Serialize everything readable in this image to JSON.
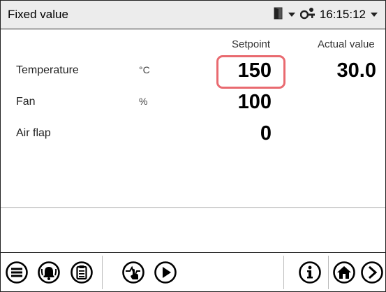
{
  "header": {
    "title": "Fixed value",
    "time": "16:15:12",
    "door_icon": "door-icon",
    "dropdown_icon": "chevron-down-icon",
    "user_icon": "user-key-icon"
  },
  "columns": {
    "setpoint": "Setpoint",
    "actual": "Actual value"
  },
  "rows": [
    {
      "label": "Temperature",
      "unit": "°C",
      "setpoint": "150",
      "actual": "30.0"
    },
    {
      "label": "Fan",
      "unit": "%",
      "setpoint": "100",
      "actual": ""
    },
    {
      "label": "Air flap",
      "unit": "",
      "setpoint": "0",
      "actual": ""
    }
  ],
  "highlight_color": "#e96a70",
  "toolbar": {
    "left": [
      "menu-icon",
      "alarm-icon",
      "clipboard-icon",
      "hand-touch-icon",
      "play-icon"
    ],
    "right": [
      "info-icon",
      "home-icon",
      "next-icon"
    ]
  }
}
